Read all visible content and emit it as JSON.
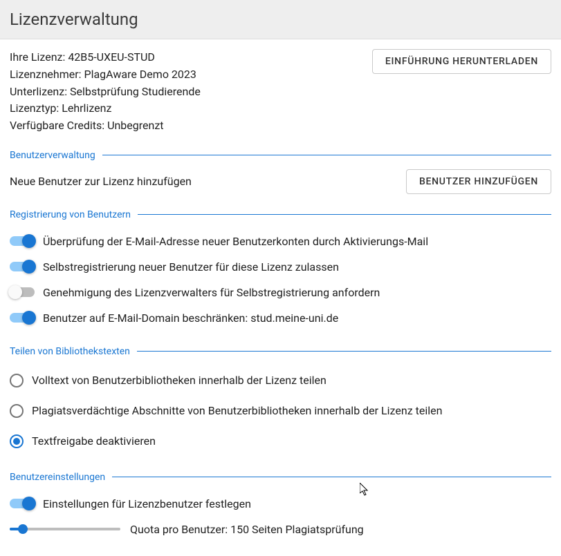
{
  "header": {
    "title": "Lizenzverwaltung"
  },
  "licenseInfo": {
    "licenseLine": "Ihre Lizenz: 42B5-UXEU-STUD",
    "licenseeLine": "Lizenznehmer: PlagAware Demo 2023",
    "sublicenseLine": "Unterlizenz: Selbstprüfung Studierende",
    "typeLine": "Lizenztyp: Lehrlizenz",
    "creditsLine": "Verfügbare Credits: Unbegrenzt"
  },
  "buttons": {
    "downloadIntro": "EINFÜHRUNG HERUNTERLADEN",
    "addUser": "BENUTZER HINZUFÜGEN"
  },
  "sections": {
    "userManagement": "Benutzerverwaltung",
    "registration": "Registrierung von Benutzern",
    "sharing": "Teilen von Bibliothekstexten",
    "userSettings": "Benutzereinstellungen"
  },
  "addUserPrompt": "Neue Benutzer zur Lizenz hinzufügen",
  "toggles": {
    "emailVerify": {
      "label": "Überprüfung der E-Mail-Adresse neuer Benutzerkonten durch Aktivierungs-Mail",
      "on": true
    },
    "selfRegister": {
      "label": "Selbstregistrierung neuer Benutzer für diese Lizenz zulassen",
      "on": true
    },
    "approval": {
      "label": "Genehmigung des Lizenzverwalters für Selbstregistrierung anfordern",
      "on": false
    },
    "domainRestrict": {
      "label": "Benutzer auf E-Mail-Domain beschränken: stud.meine-uni.de",
      "on": true
    },
    "setUserSettings": {
      "label": "Einstellungen für Lizenzbenutzer festlegen",
      "on": true
    }
  },
  "radios": {
    "fullText": {
      "label": "Volltext von Benutzerbibliotheken innerhalb der Lizenz teilen",
      "selected": false
    },
    "suspicious": {
      "label": "Plagiatsverdächtige Abschnitte von Benutzerbibliotheken innerhalb der Lizenz teilen",
      "selected": false
    },
    "disable": {
      "label": "Textfreigabe deaktivieren",
      "selected": true
    }
  },
  "slider": {
    "label": "Quota pro Benutzer: 150 Seiten Plagiatsprüfung",
    "percent": 12
  }
}
